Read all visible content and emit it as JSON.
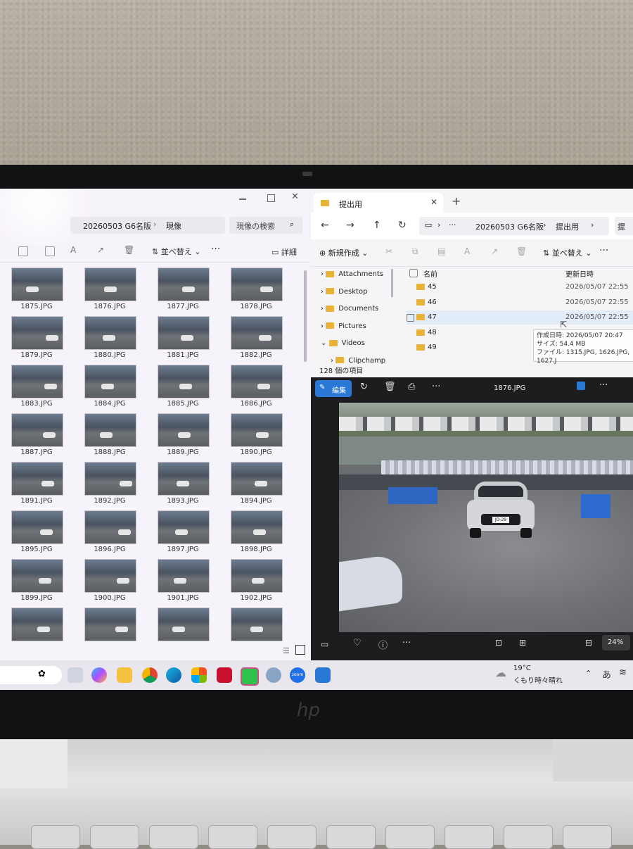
{
  "left_window": {
    "breadcrumb_folder": "20260503 G6名阪",
    "breadcrumb_sub": "現像",
    "search_placeholder": "現像の検索",
    "sort_label": "並べ替え",
    "details_label": "詳細",
    "thumbnails": [
      "1875.JPG",
      "1876.JPG",
      "1877.JPG",
      "1878.JPG",
      "1879.JPG",
      "1880.JPG",
      "1881.JPG",
      "1882.JPG",
      "1883.JPG",
      "1884.JPG",
      "1885.JPG",
      "1886.JPG",
      "1887.JPG",
      "1888.JPG",
      "1889.JPG",
      "1890.JPG",
      "1891.JPG",
      "1892.JPG",
      "1893.JPG",
      "1894.JPG",
      "1895.JPG",
      "1896.JPG",
      "1897.JPG",
      "1898.JPG",
      "1899.JPG",
      "1900.JPG",
      "1901.JPG",
      "1902.JPG",
      "",
      "",
      "",
      ""
    ]
  },
  "right_window": {
    "tab_title": "提出用",
    "breadcrumb_folder": "20260503 G6名阪",
    "breadcrumb_sub": "提出用",
    "search_partial": "提",
    "new_button": "新規作成",
    "sort_label": "並べ替え",
    "nav_items": [
      "Attachments",
      "Desktop",
      "Documents",
      "Pictures",
      "Videos",
      "Clipchamp"
    ],
    "col_name": "名前",
    "col_date": "更新日時",
    "rows": [
      {
        "name": "45",
        "date": "2026/05/07 22:55"
      },
      {
        "name": "46",
        "date": "2026/05/07 22:55"
      },
      {
        "name": "47",
        "date": "2026/05/07 22:55"
      },
      {
        "name": "48",
        "date": ""
      },
      {
        "name": "49",
        "date": ""
      }
    ],
    "tooltip": {
      "line1": "作成日時: 2026/05/07 20:47",
      "line2": "サイズ: 54.4 MB",
      "line3": "ファイル: 1315.JPG, 1626.JPG, 1627.J"
    },
    "status": "128 個の項目"
  },
  "photo_viewer": {
    "edit_label": "編集",
    "file_name": "1876.JPG",
    "zoom": "24%",
    "plate": "JD-29"
  },
  "taskbar": {
    "weather_temp": "19°C",
    "weather_desc": "くもり時々晴れ",
    "ime": "あ",
    "zoom_label": "zoom"
  },
  "colors": {
    "accent": "#2a78d6",
    "folder": "#e8b437",
    "line_green": "#2ec24a",
    "mcafee_red": "#c8102e"
  }
}
